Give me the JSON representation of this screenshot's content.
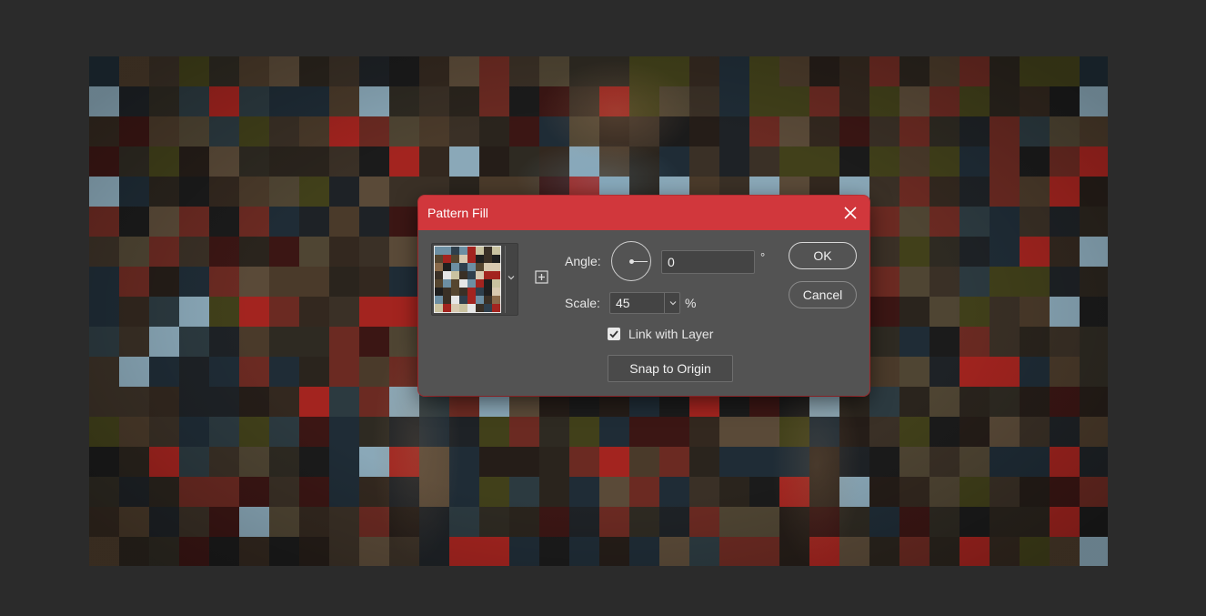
{
  "dialog": {
    "title": "Pattern Fill",
    "angle_label": "Angle:",
    "angle_value": "0",
    "angle_unit": "°",
    "scale_label": "Scale:",
    "scale_value": "45",
    "scale_unit": "%",
    "link_with_layer_label": "Link with Layer",
    "link_with_layer_checked": true,
    "snap_button_label": "Snap to Origin",
    "ok_label": "OK",
    "cancel_label": "Cancel"
  },
  "icons": {
    "close": "close-icon",
    "chevron": "chevron-down-icon",
    "new_preset": "new-preset-icon",
    "checkmark": "checkmark-icon"
  },
  "colors": {
    "accent": "#d1373c",
    "dialog_bg": "#535353",
    "workspace_bg": "#2b2b2b"
  }
}
